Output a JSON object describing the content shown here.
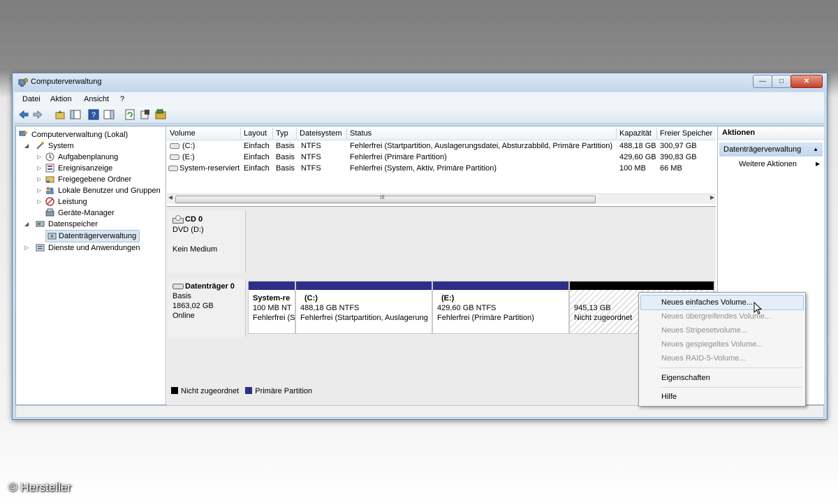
{
  "window": {
    "title": "Computerverwaltung"
  },
  "menu": [
    "Datei",
    "Aktion",
    "Ansicht",
    "?"
  ],
  "tree": {
    "root": "Computerverwaltung (Lokal)",
    "system": "System",
    "aufgaben": "Aufgabenplanung",
    "ereignis": "Ereignisanzeige",
    "freigegeben": "Freigegebene Ordner",
    "benutzer": "Lokale Benutzer und Gruppen",
    "leistung": "Leistung",
    "geraete": "Geräte-Manager",
    "datenspeicher": "Datenspeicher",
    "datentraeger": "Datenträgerverwaltung",
    "dienste": "Dienste und Anwendungen"
  },
  "volumes": {
    "headers": [
      "Volume",
      "Layout",
      "Typ",
      "Dateisystem",
      "Status",
      "Kapazität",
      "Freier Speicher"
    ],
    "rows": [
      [
        "(C:)",
        "Einfach",
        "Basis",
        "NTFS",
        "Fehlerfrei (Startpartition, Auslagerungsdatei, Absturzabbild, Primäre Partition)",
        "488,18 GB",
        "300,97 GB"
      ],
      [
        "(E:)",
        "Einfach",
        "Basis",
        "NTFS",
        "Fehlerfrei (Primäre Partition)",
        "429,60 GB",
        "390,83 GB"
      ],
      [
        "System-reserviert",
        "Einfach",
        "Basis",
        "NTFS",
        "Fehlerfrei (System, Aktiv, Primäre Partition)",
        "100 MB",
        "66 MB"
      ]
    ],
    "scroll_marker": "III"
  },
  "cd": {
    "name": "CD 0",
    "drive": "DVD (D:)",
    "status": "Kein Medium"
  },
  "disk0": {
    "name": "Datenträger 0",
    "type": "Basis",
    "size": "1863,02 GB",
    "status": "Online",
    "partitions": [
      {
        "title": "System-re",
        "line1": "100 MB NT",
        "line2": "Fehlerfrei (S"
      },
      {
        "title": "(C:)",
        "line1": "488,18 GB NTFS",
        "line2": "Fehlerfrei (Startpartition, Auslagerung"
      },
      {
        "title": "(E:)",
        "line1": "429,60 GB NTFS",
        "line2": "Fehlerfrei (Primäre Partition)"
      },
      {
        "title": "",
        "line1": "945,13 GB",
        "line2": "Nicht zugeordnet"
      }
    ]
  },
  "legend": {
    "unallocated": "Nicht zugeordnet",
    "primary": "Primäre Partition"
  },
  "actions": {
    "header": "Aktionen",
    "section": "Datenträgerverwaltung",
    "more": "Weitere Aktionen"
  },
  "context_menu": {
    "items": [
      "Neues einfaches Volume...",
      "Neues übergreifendes Volume...",
      "Neues Stripesetvolume...",
      "Neues gespiegeltes Volume...",
      "Neues RAID-5-Volume...",
      "Eigenschaften",
      "Hilfe"
    ]
  },
  "copyright": "© Hersteller",
  "colors": {
    "primary_partition": "#2e2d8a",
    "unallocated": "#000000",
    "title_bar": "#c2d6ec"
  }
}
